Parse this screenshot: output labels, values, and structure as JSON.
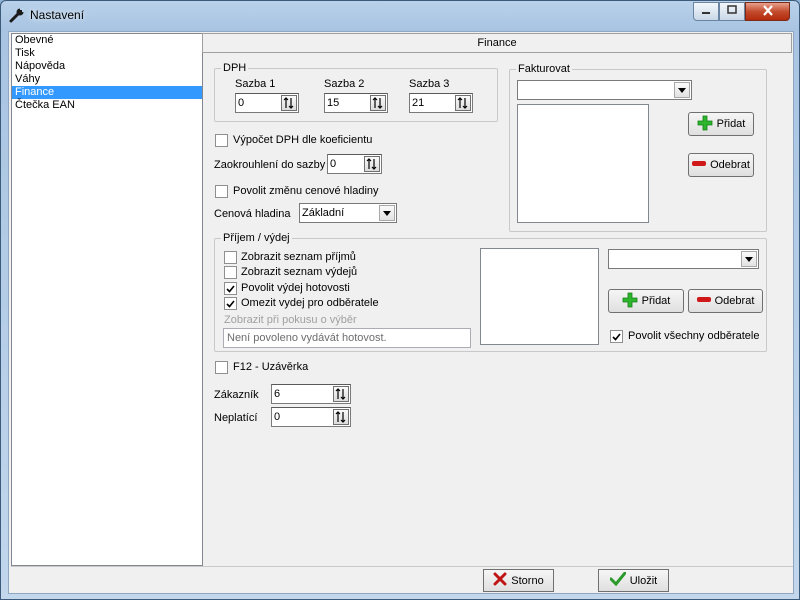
{
  "window": {
    "title": "Nastavení",
    "minimize_icon": "minimize-icon",
    "maximize_icon": "maximize-icon",
    "close_icon": "close-icon",
    "app_icon": "wrench-icon"
  },
  "sidebar": {
    "items": [
      {
        "label": "Obevné",
        "selected": false
      },
      {
        "label": "Tisk",
        "selected": false
      },
      {
        "label": "Nápověda",
        "selected": false
      },
      {
        "label": "Váhy",
        "selected": false
      },
      {
        "label": "Finance",
        "selected": true
      },
      {
        "label": "Čtečka EAN",
        "selected": false
      }
    ]
  },
  "panel": {
    "header": "Finance"
  },
  "dph": {
    "legend": "DPH",
    "sazba1": {
      "label": "Sazba 1",
      "value": "0"
    },
    "sazba2": {
      "label": "Sazba 2",
      "value": "15"
    },
    "sazba3": {
      "label": "Sazba 3",
      "value": "21"
    }
  },
  "options": {
    "vypocet_dph": {
      "label": "Výpočet DPH dle koeficientu",
      "checked": false
    },
    "zaokrouhleni": {
      "label": "Zaokrouhlení do sazby",
      "value": "0"
    },
    "zmena_hladiny": {
      "label": "Povolit změnu cenové hladiny",
      "checked": false
    },
    "cenova_hladina": {
      "label": "Cenová hladina",
      "value": "Základní"
    }
  },
  "fakturovat": {
    "legend": "Fakturovat",
    "select_value": "",
    "add_label": "Přidat",
    "remove_label": "Odebrat"
  },
  "prijem": {
    "legend": "Příjem / výdej",
    "checks": [
      {
        "label": "Zobrazit seznam příjmů",
        "checked": false
      },
      {
        "label": "Zobrazit seznam výdejů",
        "checked": false
      },
      {
        "label": "Povolit výdej hotovosti",
        "checked": true
      },
      {
        "label": "Omezit vydej pro odběratele",
        "checked": true
      }
    ],
    "message_label": "Zobrazit při pokusu o výběr",
    "message_value": "Není povoleno vydávát hotovost.",
    "select_value": "",
    "add_label": "Přidat",
    "remove_label": "Odebrat",
    "all_customers": {
      "label": "Povolit všechny odběratele",
      "checked": true
    }
  },
  "uzaverka": {
    "label": "F12 - Uzávěrka",
    "checked": false
  },
  "zakaznik": {
    "label": "Zákazník",
    "value": "6"
  },
  "neplatici": {
    "label": "Neplatící",
    "value": "0"
  },
  "footer": {
    "cancel_label": "Storno",
    "save_label": "Uložit"
  },
  "colors": {
    "selection": "#3399ff",
    "add_green": "#2db52d",
    "remove_red": "#d01818",
    "cancel_red": "#c01515",
    "save_green": "#2a9a2a"
  }
}
